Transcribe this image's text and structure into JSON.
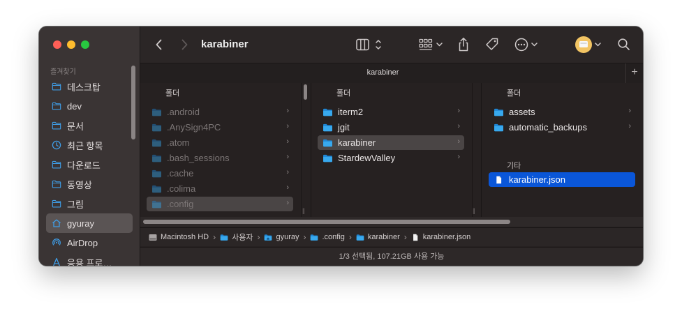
{
  "sidebar": {
    "section_title": "즐겨찾기",
    "items": [
      {
        "label": "데스크탑",
        "icon": "folder-icon"
      },
      {
        "label": "dev",
        "icon": "folder-icon"
      },
      {
        "label": "문서",
        "icon": "folder-icon"
      },
      {
        "label": "최근 항목",
        "icon": "clock-icon"
      },
      {
        "label": "다운로드",
        "icon": "folder-icon"
      },
      {
        "label": "동영상",
        "icon": "folder-icon"
      },
      {
        "label": "그림",
        "icon": "folder-icon"
      },
      {
        "label": "gyuray",
        "icon": "home-icon"
      },
      {
        "label": "AirDrop",
        "icon": "airdrop-icon"
      },
      {
        "label": "응용 프로…",
        "icon": "applications-icon"
      }
    ]
  },
  "toolbar": {
    "title": "karabiner"
  },
  "tab": {
    "title": "karabiner",
    "add": "+"
  },
  "columns": [
    {
      "header": "폴더",
      "items": [
        ".android",
        ".AnySign4PC",
        ".atom",
        ".bash_sessions",
        ".cache",
        ".colima",
        ".config"
      ]
    },
    {
      "header": "폴더",
      "items": [
        "iterm2",
        "jgit",
        "karabiner",
        "StardewValley"
      ]
    },
    {
      "header": "폴더",
      "items": [
        "assets",
        "automatic_backups"
      ],
      "other_header": "기타",
      "files": [
        "karabiner.json"
      ]
    }
  ],
  "path": [
    "Macintosh HD",
    "사용자",
    "gyuray",
    ".config",
    "karabiner",
    "karabiner.json"
  ],
  "status": "1/3 선택됨, 107.21GB 사용 가능",
  "colors": {
    "accent": "#0a56d8",
    "folder": "#2c9fe8",
    "close": "#fe5f57",
    "minimize": "#febc2e",
    "maximize": "#28c840"
  }
}
